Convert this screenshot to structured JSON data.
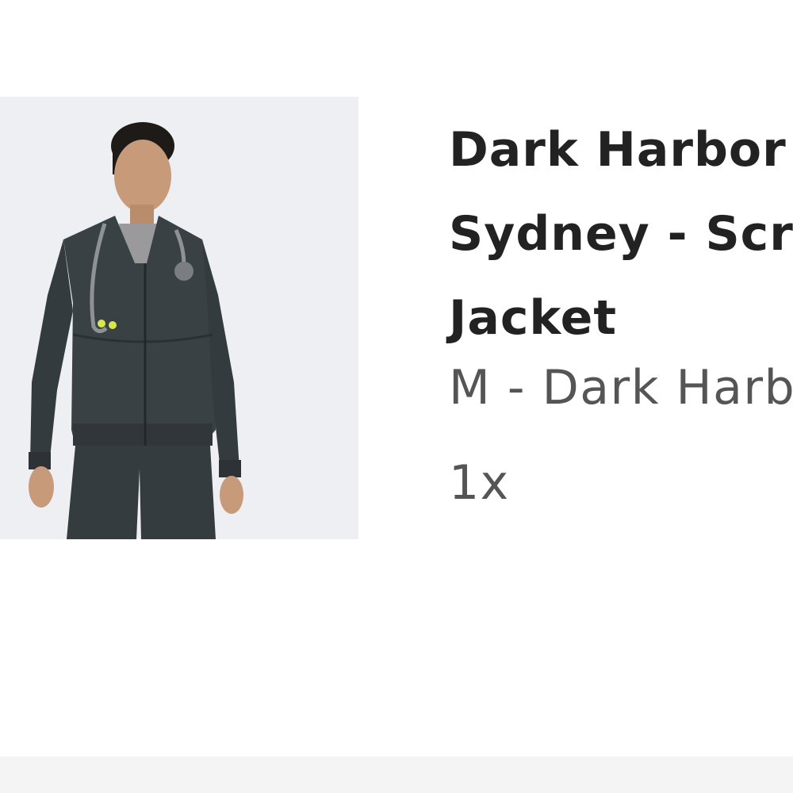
{
  "product": {
    "image_alt": "Woman wearing dark harbor scrub jacket with stethoscope",
    "title_lines": [
      "Dark Harbor",
      "Sydney - Scrub",
      "Jacket"
    ],
    "variant": "M - Dark Harbor",
    "quantity": "1x"
  },
  "colors": {
    "background": "#ffffff",
    "image_background": "#eeeff2",
    "title_text": "#222222",
    "secondary_text": "#555555",
    "jacket": "#3a4145"
  }
}
